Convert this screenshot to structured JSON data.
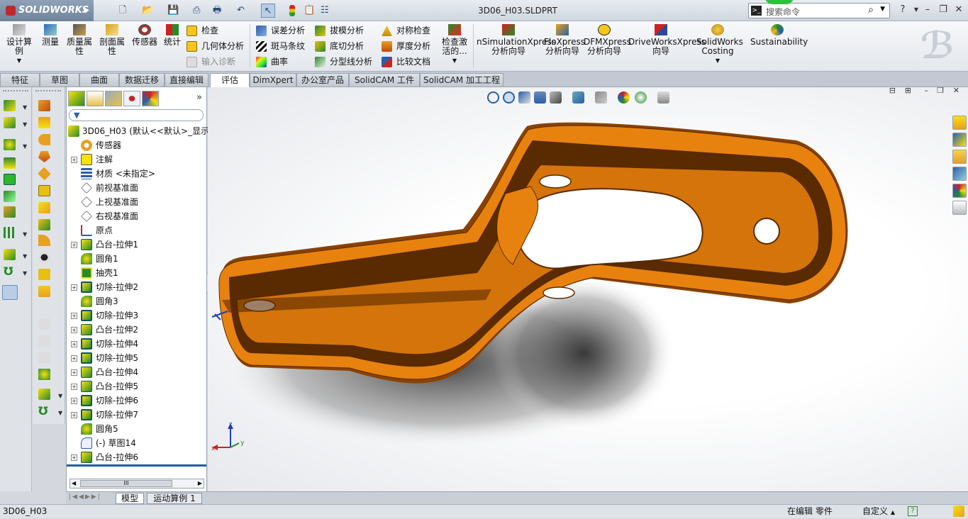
{
  "app": {
    "logo": "SOLIDWORKS",
    "document_title": "3D06_H03.SLDPRT"
  },
  "search": {
    "placeholder": "搜索命令"
  },
  "ribbon": {
    "design_study": "设计算例",
    "measure": "测量",
    "mass_props": "质量属性",
    "section_props": "剖面属性",
    "sensor": "传感器",
    "statistics": "统计",
    "check": "检查",
    "geometry_analysis": "几何体分析",
    "import_diagnostics": "输入诊断",
    "deviation_analysis": "误差分析",
    "zebra_stripes": "斑马条纹",
    "curvature": "曲率",
    "draft_analysis": "拔模分析",
    "undercut_analysis": "底切分析",
    "parting_line_analysis": "分型线分析",
    "symmetry_check": "对称检查",
    "thickness_analysis": "厚度分析",
    "compare_documents": "比较文档",
    "check_active": "检查激活的...",
    "simxpress": "nSimulationXpress分析向导",
    "floxpress": "FloXpress分析向导",
    "dfmxpress": "DFMXpress分析向导",
    "driveworks": "DriveWorksXpress向导",
    "costing": "SolidWorks Costing",
    "sustainability": "Sustainability"
  },
  "tabs": [
    "特征",
    "草图",
    "曲面",
    "数据迁移",
    "直接编辑",
    "评估",
    "DimXpert",
    "办公室产品",
    "SolidCAM 工件",
    "SolidCAM 加工工程"
  ],
  "active_tab": "评估",
  "tree": {
    "root": "3D06_H03  (默认<<默认>_显示",
    "items": [
      {
        "label": "传感器",
        "icon": "sensor-icon",
        "expander": false
      },
      {
        "label": "注解",
        "icon": "annotation-icon",
        "expander": true
      },
      {
        "label": "材质 <未指定>",
        "icon": "material-icon",
        "expander": false
      },
      {
        "label": "前视基准面",
        "icon": "plane-icon",
        "expander": false
      },
      {
        "label": "上视基准面",
        "icon": "plane-icon",
        "expander": false
      },
      {
        "label": "右视基准面",
        "icon": "plane-icon",
        "expander": false
      },
      {
        "label": "原点",
        "icon": "origin-icon",
        "expander": false
      },
      {
        "label": "凸台-拉伸1",
        "icon": "boss-extrude-icon",
        "expander": true
      },
      {
        "label": "圆角1",
        "icon": "fillet-icon",
        "expander": false
      },
      {
        "label": "抽壳1",
        "icon": "shell-icon",
        "expander": false
      },
      {
        "label": "切除-拉伸2",
        "icon": "cut-extrude-icon",
        "expander": true
      },
      {
        "label": "圆角3",
        "icon": "fillet-icon",
        "expander": false
      },
      {
        "label": "切除-拉伸3",
        "icon": "cut-extrude-icon",
        "expander": true
      },
      {
        "label": "凸台-拉伸2",
        "icon": "boss-extrude-icon",
        "expander": true
      },
      {
        "label": "切除-拉伸4",
        "icon": "cut-extrude-icon",
        "expander": true
      },
      {
        "label": "切除-拉伸5",
        "icon": "cut-extrude-icon",
        "expander": true
      },
      {
        "label": "凸台-拉伸4",
        "icon": "boss-extrude-icon",
        "expander": true
      },
      {
        "label": "凸台-拉伸5",
        "icon": "boss-extrude-icon",
        "expander": true
      },
      {
        "label": "切除-拉伸6",
        "icon": "cut-extrude-icon",
        "expander": true
      },
      {
        "label": "切除-拉伸7",
        "icon": "cut-extrude-icon",
        "expander": true
      },
      {
        "label": "圆角5",
        "icon": "fillet-icon",
        "expander": false
      },
      {
        "label": "(-) 草图14",
        "icon": "sketch-icon",
        "expander": false
      },
      {
        "label": "凸台-拉伸6",
        "icon": "boss-extrude-icon",
        "expander": true
      }
    ],
    "scroll_thumb": "III"
  },
  "bottom_tabs": [
    "模型",
    "运动算例 1"
  ],
  "status": {
    "doc": "3D06_H03",
    "mode": "在编辑 零件",
    "units": "自定义"
  },
  "axes": {
    "x": "x",
    "y": "y",
    "z": "z"
  },
  "colors": {
    "part_face": "#e8820e",
    "part_dark": "#7a3a00",
    "accent": "#1f5fa8"
  }
}
